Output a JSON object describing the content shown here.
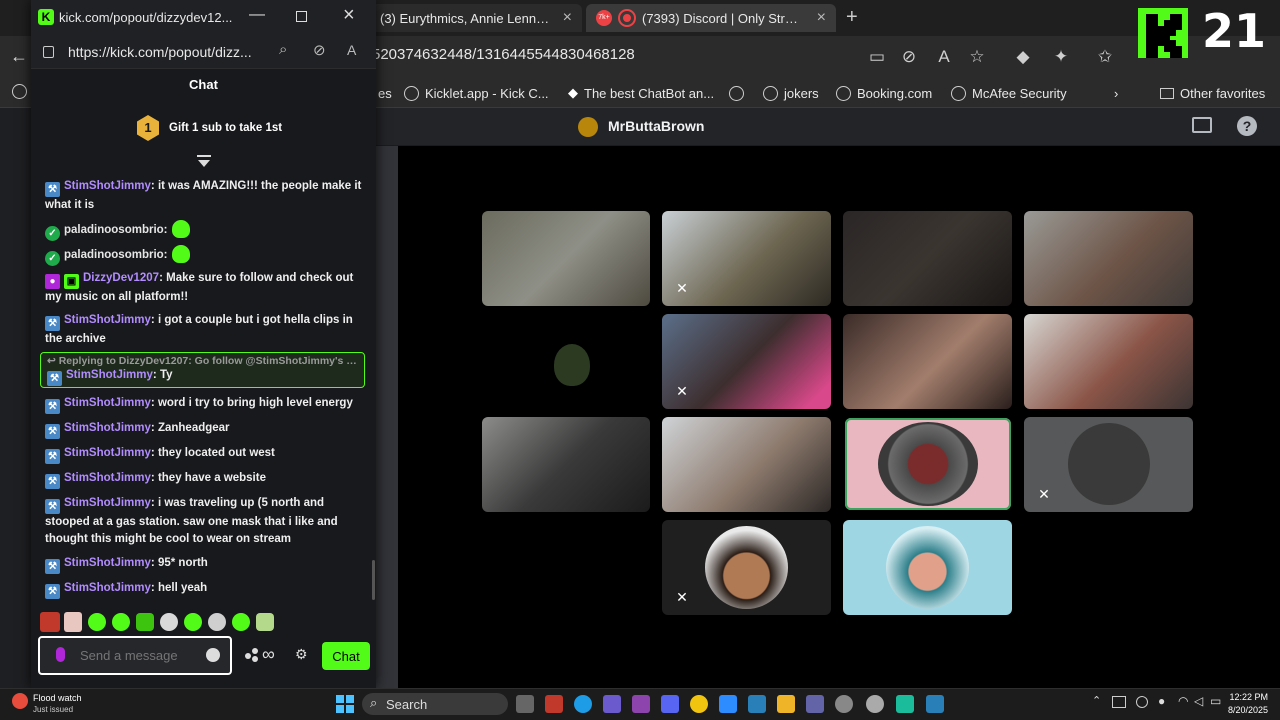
{
  "browser": {
    "tabs": [
      {
        "label": "(3) Eurythmics, Annie Lennox, Da",
        "favicon_color": "#ff0033"
      },
      {
        "label": "(7393) Discord | Only Stream",
        "favicon_color": "#ed4245",
        "badge": "7k+"
      }
    ],
    "url": "520374632448/1316445544830468128",
    "bookmarks": [
      "es",
      "Kicklet.app - Kick C...",
      "The best ChatBot an...",
      "jokers",
      "Booking.com",
      "McAfee Security"
    ],
    "other_favorites": "Other favorites"
  },
  "discord": {
    "channel_title": "MrButtaBrown"
  },
  "overlay": {
    "number": "21"
  },
  "popup": {
    "title": "kick.com/popout/dizzydev12...",
    "url": "https://kick.com/popout/dizz...",
    "chat_header": "Chat",
    "gift_rank": "1",
    "gift_text": "Gift 1 sub to take 1st",
    "messages": [
      {
        "user": "StimShotJimmy",
        "text": "it was AMAZING!!! the people make it what it is"
      },
      {
        "user": "paladinoosombrio",
        "text": ":"
      },
      {
        "user": "paladinoosombrio",
        "text": ":"
      },
      {
        "user": "DizzyDev1207",
        "text": "Make sure to follow and check out my music on all platform!!"
      },
      {
        "user": "StimShotJimmy",
        "text": "i got a couple but i got hella clips in the archive"
      },
      {
        "user": "StimShotJimmy",
        "text": "word i try to bring high level energy"
      },
      {
        "user": "StimShotJimmy",
        "text": "Zanheadgear"
      },
      {
        "user": "StimShotJimmy",
        "text": "they located out west"
      },
      {
        "user": "StimShotJimmy",
        "text": "they have a website"
      },
      {
        "user": "StimShotJimmy",
        "text": "i was traveling up (5 north and stooped at a gas station. saw one mask that i like and thought this might be cool to wear on stream"
      },
      {
        "user": "StimShotJimmy",
        "text": "95* north"
      },
      {
        "user": "StimShotJimmy",
        "text": "hell yeah"
      }
    ],
    "reply": {
      "context": "Replying to DizzyDev1207: Go follow @StimShotJimmy's ch...",
      "user": "StimShotJimmy",
      "text": "Ty"
    },
    "input_placeholder": "Send a message",
    "chat_button": "Chat"
  },
  "taskbar": {
    "notification_title": "Flood watch",
    "notification_sub": "Just issued",
    "search_label": "Search",
    "time": "12:22 PM",
    "date": "8/20/2025"
  },
  "colors": {
    "kick_green": "#53fc18",
    "username_purple": "#b28dff",
    "speaking_green": "#3ba55d"
  }
}
